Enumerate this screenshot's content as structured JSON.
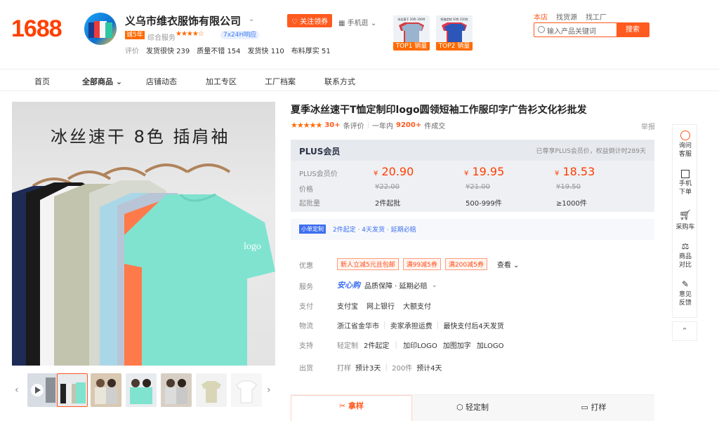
{
  "header": {
    "logo": "1688",
    "shop_name": "义乌市维衣服饰有限公司",
    "year_badge": "诚5年",
    "rating_label": "综合服务",
    "stars": "★★★★☆",
    "service_badge": "7x24H响应",
    "eval_label": "评价",
    "eval_items": [
      "发货很快 239",
      "质量不错 154",
      "发货快 110",
      "布料厚实 51"
    ],
    "follow_label": "关注领券",
    "mobile_label": "手机逛",
    "top_products": [
      {
        "caption": "TOP1 销量",
        "label": "冰丝速干 10色 100件"
      },
      {
        "caption": "TOP2 销量",
        "label": "短袖定制 10色 220克"
      }
    ],
    "scope_tabs": [
      "本店",
      "找货源",
      "找工厂"
    ],
    "search_placeholder": "输入产品关键词",
    "search_button": "搜索"
  },
  "nav": {
    "items": [
      "首页",
      "全部商品",
      "店铺动态",
      "加工专区",
      "工厂档案",
      "联系方式"
    ]
  },
  "gallery": {
    "hero_text": "冰丝速干  8色  插肩袖",
    "logo_mark": "logo",
    "thumb_count": 7
  },
  "product": {
    "title": "夏季冰丝速干T恤定制印logo圆领短袖工作服印字广告衫文化衫批发",
    "review_stars": "★★★★★",
    "review_count": "30+",
    "review_label": "条评价",
    "sales_period": "一年内",
    "sales_count": "9200+",
    "sales_label": "件成交",
    "report": "举报"
  },
  "plus": {
    "label": "PLUS会员",
    "note": "已尊享PLUS会员价，权益倒计时289天",
    "row_labels": [
      "PLUS会员价",
      "价格",
      "起批量"
    ],
    "tiers": [
      {
        "plus_price": "20.90",
        "price": "¥22.00",
        "moq": "2件起批"
      },
      {
        "plus_price": "19.95",
        "price": "¥21.00",
        "moq": "500-999件"
      },
      {
        "plus_price": "18.53",
        "price": "¥19.50",
        "moq": "≥1000件"
      }
    ],
    "currency": "¥"
  },
  "custom": {
    "tag": "小单定制",
    "text": "2件起定 · 4天发货 · 延期必赔"
  },
  "options": {
    "discount_label": "优惠",
    "coupons": [
      "新人立减5元且包邮",
      "满99减5券",
      "满200减5券"
    ],
    "coupon_more": "查看",
    "service_label": "服务",
    "service_brand": "安心购",
    "service_text": "品质保障 · 延期必赔",
    "pay_label": "支付",
    "pay_items": [
      "支付宝",
      "网上银行",
      "大额支付"
    ],
    "logistics_label": "物流",
    "logistics_items": [
      "浙江省金华市",
      "卖家承担运费",
      "最快支付后4天发货"
    ],
    "support_label": "支持",
    "support_sub": "轻定制",
    "support_items": [
      "2件起定",
      "加印LOGO",
      "加图加字",
      "加LOGO"
    ],
    "ship_label": "出货",
    "ship_items": [
      {
        "k": "打样",
        "v": "预计3天"
      },
      {
        "k": "200件",
        "v": "预计4天"
      }
    ]
  },
  "bottom_tabs": [
    "拿样",
    "轻定制",
    "打样"
  ],
  "sidebar": {
    "items": [
      "询问客服",
      "手机下单",
      "采购车",
      "商品对比",
      "意见反馈"
    ]
  },
  "colors": {
    "brand": "#ff5a1f",
    "price": "#ff3d00"
  }
}
